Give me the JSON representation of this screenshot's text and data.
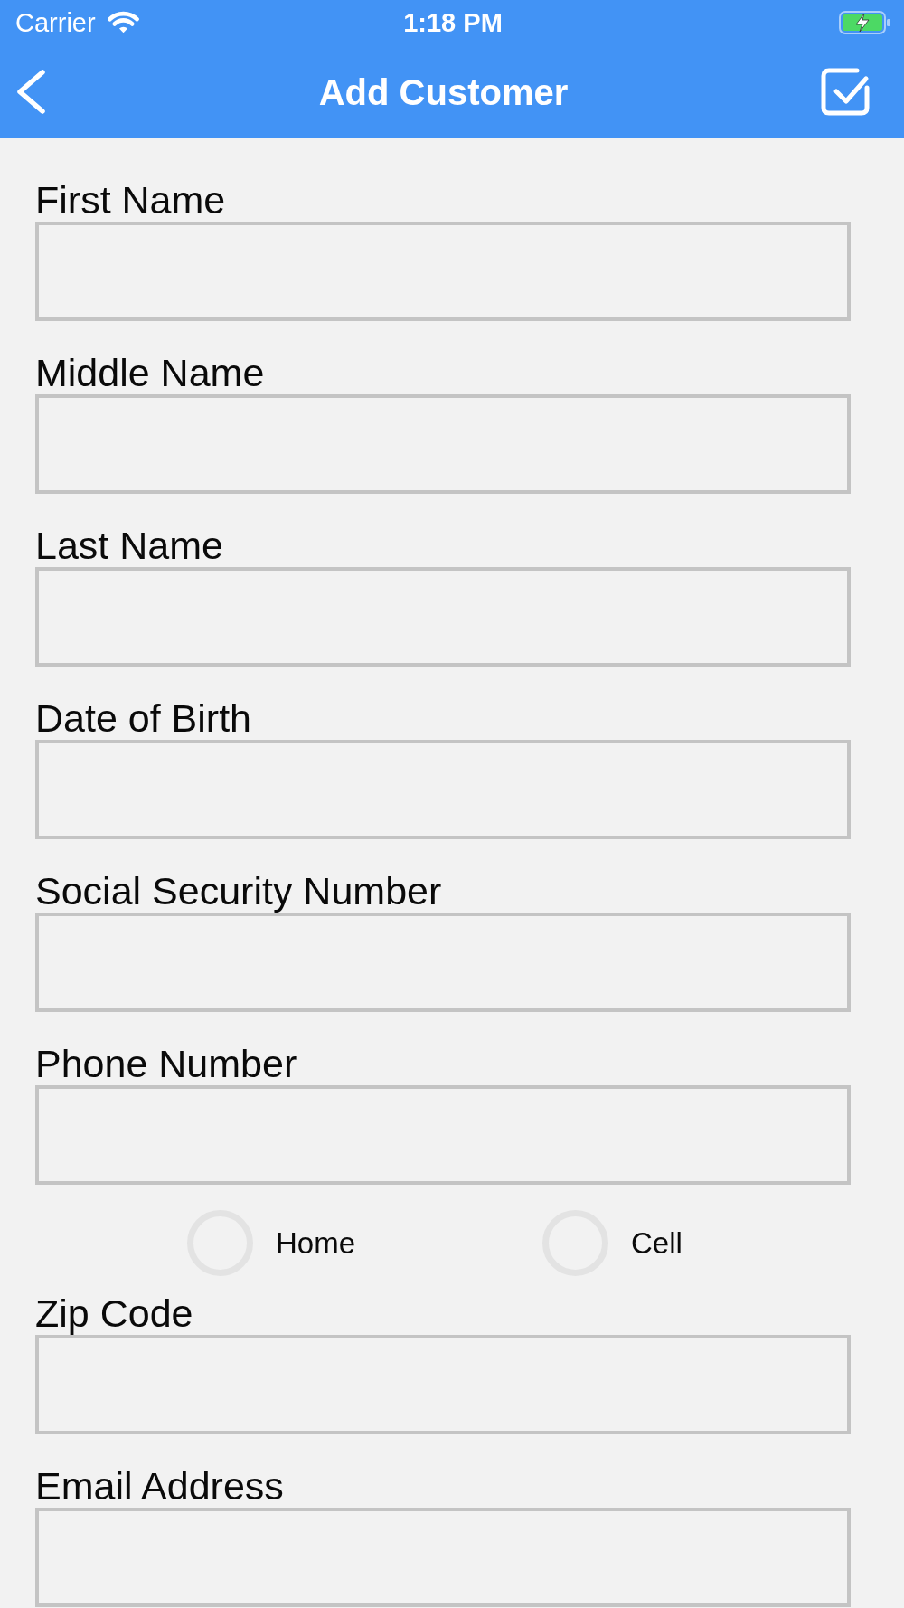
{
  "status_bar": {
    "carrier": "Carrier",
    "time": "1:18 PM"
  },
  "nav_bar": {
    "title": "Add Customer"
  },
  "form": [
    {
      "kind": "text_field",
      "label": "First Name"
    },
    {
      "kind": "text_field",
      "label": "Middle Name"
    },
    {
      "kind": "text_field",
      "label": "Last Name"
    },
    {
      "kind": "text_field",
      "label": "Date of Birth"
    },
    {
      "kind": "text_field",
      "label": "Social Security Number"
    },
    {
      "kind": "text_field",
      "label": "Phone Number"
    },
    {
      "kind": "radio_group",
      "options": [
        {
          "label": "Home",
          "selected": false
        },
        {
          "label": "Cell",
          "selected": false
        }
      ]
    },
    {
      "kind": "text_field",
      "label": "Zip Code"
    },
    {
      "kind": "text_field",
      "label": "Email Address"
    }
  ]
}
